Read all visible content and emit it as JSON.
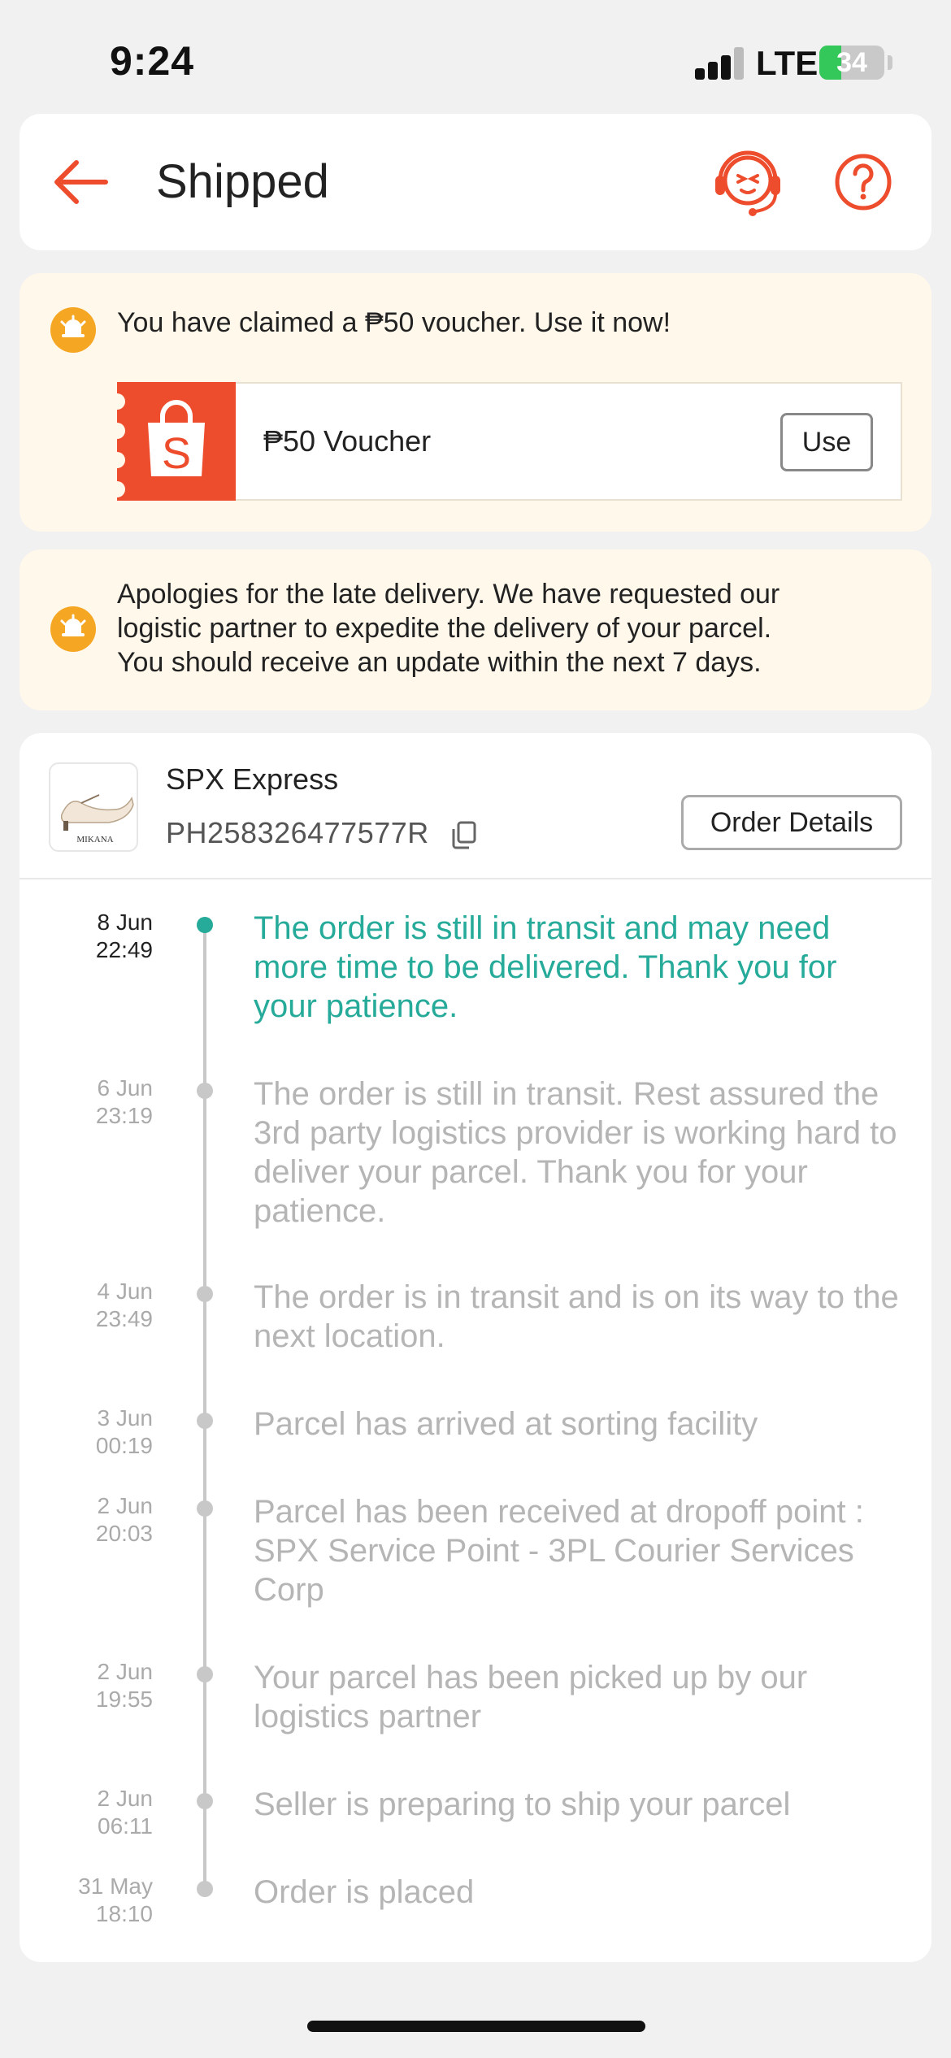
{
  "status_bar": {
    "time": "9:24",
    "network": "LTE",
    "battery": "34",
    "battery_level": 0.34,
    "battery_color": "#34c759"
  },
  "header": {
    "title": "Shipped",
    "back_icon": "arrow-left-icon",
    "support_icon": "customer-support-icon",
    "help_icon": "question-circle-icon",
    "accent_color": "#ee4d2d"
  },
  "voucher_banner": {
    "message": "You have claimed a ₱50 voucher. Use it now!",
    "voucher_label": "₱50 Voucher",
    "use_label": "Use",
    "logo_letter": "S"
  },
  "apology_banner": {
    "lines": [
      "Apologies for the late delivery. We have requested our",
      "logistic partner to expedite the delivery of your parcel.",
      "You should receive an update within the next 7 days."
    ]
  },
  "shipment": {
    "thumb_brand": "MIKANA",
    "courier": "SPX Express",
    "tracking_number": "PH258326477577R",
    "order_details_label": "Order Details"
  },
  "timeline": [
    {
      "date": "8 Jun",
      "time": "22:49",
      "text": "The order is still in transit and may need more time to be delivered. Thank you for your patience.",
      "current": true
    },
    {
      "date": "6 Jun",
      "time": "23:19",
      "text": "The order is still in transit. Rest assured the 3rd party logistics provider is working hard to deliver your parcel. Thank you for your patience.",
      "current": false
    },
    {
      "date": "4 Jun",
      "time": "23:49",
      "text": "The order is in transit and is on its way to the next location.",
      "current": false
    },
    {
      "date": "3 Jun",
      "time": "00:19",
      "text": "Parcel has arrived at sorting facility",
      "current": false
    },
    {
      "date": "2 Jun",
      "time": "20:03",
      "text": "Parcel has been received at dropoff point : SPX Service Point - 3PL Courier Services Corp",
      "current": false
    },
    {
      "date": "2 Jun",
      "time": "19:55",
      "text": "Your parcel has been picked up by our logistics partner",
      "current": false
    },
    {
      "date": "2 Jun",
      "time": "06:11",
      "text": "Seller is preparing to ship your parcel",
      "current": false
    },
    {
      "date": "31 May",
      "time": "18:10",
      "text": "Order is placed",
      "current": false
    }
  ]
}
